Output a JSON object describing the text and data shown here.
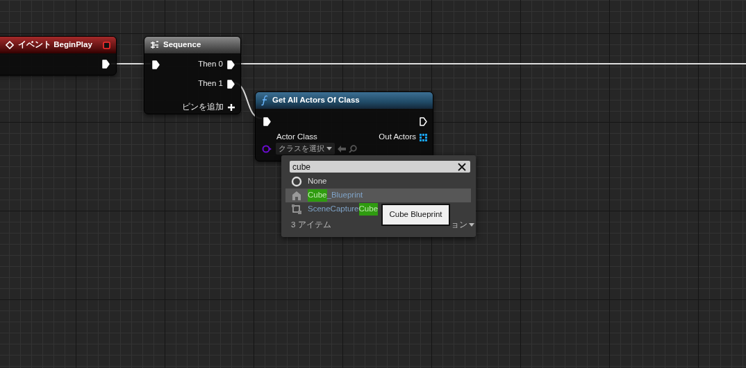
{
  "nodes": [
    {
      "kind": "event",
      "title": "イベント BeginPlay",
      "outputs": [
        {
          "kind": "exec"
        }
      ]
    },
    {
      "kind": "sequence",
      "title": "Sequence",
      "outputs": [
        {
          "kind": "exec",
          "label": "Then 0"
        },
        {
          "kind": "exec",
          "label": "Then 1"
        }
      ],
      "add_pin": "ピンを追加"
    },
    {
      "kind": "function",
      "title": "Get All Actors Of Class",
      "input_label": "Actor Class",
      "output_label": "Out Actors",
      "class_picker": "クラスを選択"
    }
  ],
  "class_menu": {
    "search": "cube",
    "items": [
      {
        "kind": "none",
        "selected": false,
        "segments": [
          {
            "text": "None",
            "highlighted": false
          }
        ]
      },
      {
        "kind": "blueprint",
        "selected": true,
        "segments": [
          {
            "text": "Cube",
            "highlighted": true
          },
          {
            "text": "_Blueprint",
            "highlighted": false
          }
        ]
      },
      {
        "kind": "capture",
        "selected": false,
        "segments": [
          {
            "text": "SceneCapture",
            "highlighted": false
          },
          {
            "text": "Cube",
            "highlighted": true
          }
        ]
      }
    ],
    "count": "3 アイテム",
    "view_options": "ョン"
  },
  "tooltip": "Cube Blueprint"
}
